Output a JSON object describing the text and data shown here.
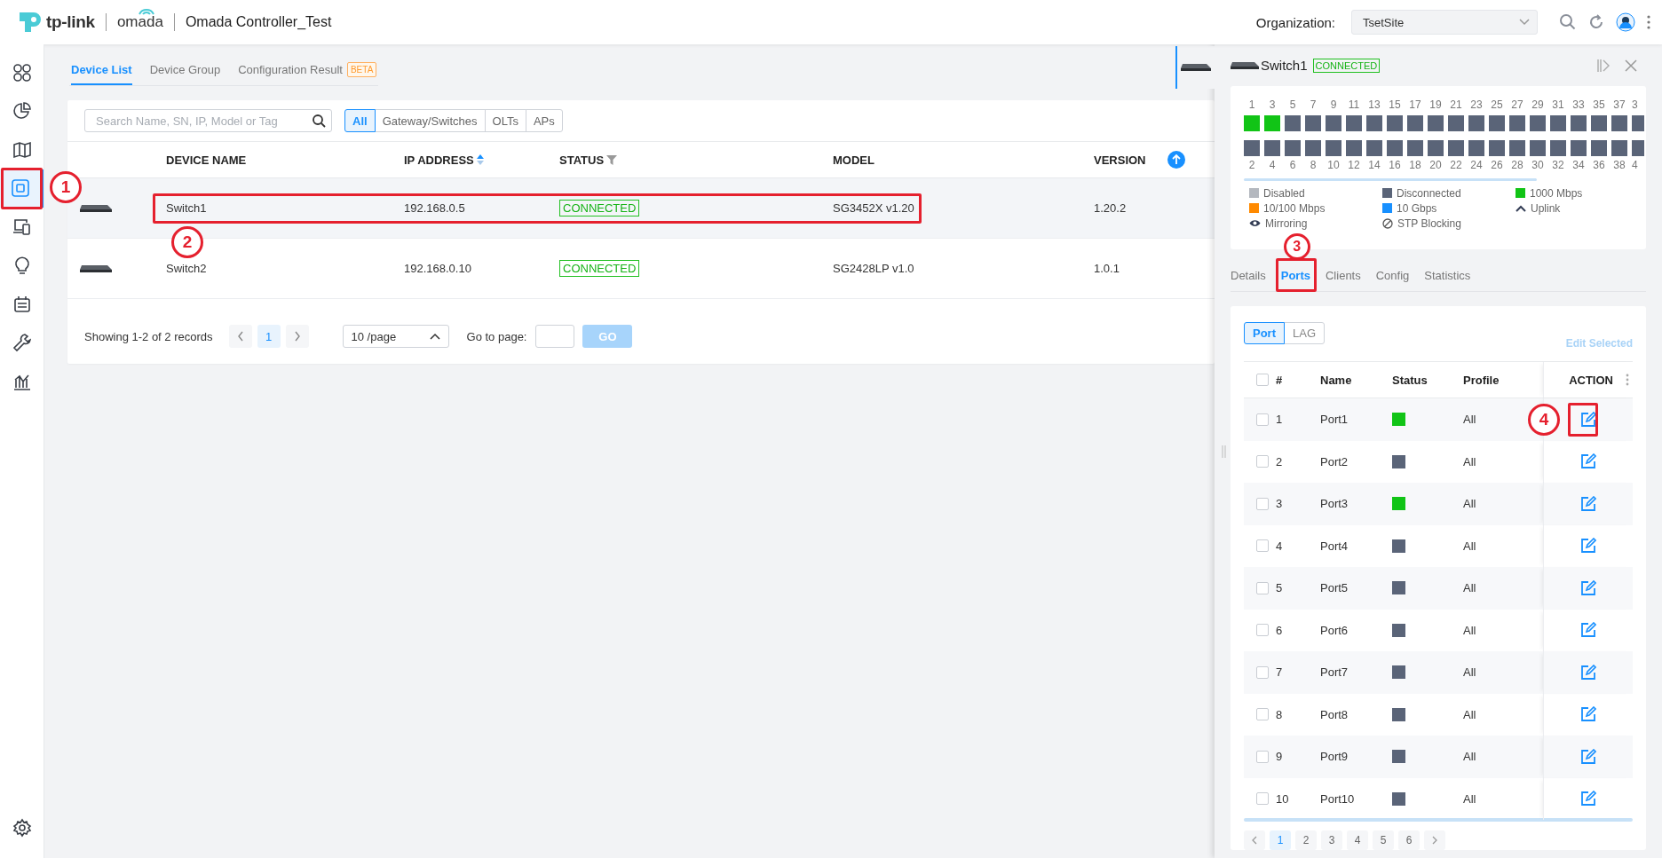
{
  "header": {
    "brand": "tp-link",
    "product": "omada",
    "title": "Omada Controller_Test",
    "organization_label": "Organization:",
    "organization": "TsetSite"
  },
  "sidebar": {
    "items": [
      {
        "kind": "dashboard",
        "selected": false
      },
      {
        "kind": "statistics",
        "selected": false
      },
      {
        "kind": "map",
        "selected": false
      },
      {
        "kind": "devices",
        "selected": true,
        "callout": "1"
      },
      {
        "kind": "clients",
        "selected": false
      },
      {
        "kind": "insight",
        "selected": false
      },
      {
        "kind": "logs",
        "selected": false
      },
      {
        "kind": "tools",
        "selected": false
      },
      {
        "kind": "reports",
        "selected": false
      }
    ],
    "bottom_items": [
      {
        "kind": "settings",
        "selected": false
      }
    ]
  },
  "tabs": [
    {
      "label": "Device List",
      "selected": true
    },
    {
      "label": "Device Group",
      "selected": false
    },
    {
      "label": "Configuration Result",
      "selected": false,
      "badge": "BETA"
    }
  ],
  "search": {
    "placeholder": "Search Name, SN, IP, Model or Tag"
  },
  "filters": [
    {
      "label": "All",
      "selected": true
    },
    {
      "label": "Gateway/Switches",
      "selected": false
    },
    {
      "label": "OLTs",
      "selected": false
    },
    {
      "label": "APs",
      "selected": false
    }
  ],
  "table": {
    "columns": [
      {
        "label": "DEVICE NAME",
        "kind": "plain"
      },
      {
        "label": "IP ADDRESS",
        "kind": "sortable"
      },
      {
        "label": "STATUS",
        "kind": "filterable"
      },
      {
        "label": "MODEL",
        "kind": "plain"
      },
      {
        "label": "VERSION",
        "kind": "upgrade"
      }
    ],
    "rows": [
      {
        "name": "Switch1",
        "ip": "192.168.0.5",
        "status": "CONNECTED",
        "model": "SG3452X v1.20",
        "version": "1.20.2",
        "hovered": true,
        "callout": "2"
      },
      {
        "name": "Switch2",
        "ip": "192.168.0.10",
        "status": "CONNECTED",
        "model": "SG2428LP v1.0",
        "version": "1.0.1",
        "hovered": false
      }
    ]
  },
  "pagination": {
    "summary": "Showing 1-2 of 2 records",
    "pages": [
      {
        "label": "1",
        "selected": true
      }
    ],
    "page_size": "10 /page",
    "goto_label": "Go to page:",
    "go": "GO"
  },
  "panel": {
    "device_name": "Switch1",
    "status": "CONNECTED",
    "ports": [
      {
        "label": "1",
        "color": "#11c416"
      },
      {
        "label": "2",
        "color": "#5a6478"
      },
      {
        "label": "3",
        "color": "#11c416"
      },
      {
        "label": "4",
        "color": "#5a6478"
      },
      {
        "label": "5",
        "color": "#5a6478"
      },
      {
        "label": "6",
        "color": "#5a6478"
      },
      {
        "label": "7",
        "color": "#5a6478"
      },
      {
        "label": "8",
        "color": "#5a6478"
      },
      {
        "label": "9",
        "color": "#5a6478"
      },
      {
        "label": "10",
        "color": "#5a6478"
      },
      {
        "label": "11",
        "color": "#5a6478"
      },
      {
        "label": "12",
        "color": "#5a6478"
      },
      {
        "label": "13",
        "color": "#5a6478"
      },
      {
        "label": "14",
        "color": "#5a6478"
      },
      {
        "label": "15",
        "color": "#5a6478"
      },
      {
        "label": "16",
        "color": "#5a6478"
      },
      {
        "label": "17",
        "color": "#5a6478"
      },
      {
        "label": "18",
        "color": "#5a6478"
      },
      {
        "label": "19",
        "color": "#5a6478"
      },
      {
        "label": "20",
        "color": "#5a6478"
      },
      {
        "label": "21",
        "color": "#5a6478"
      },
      {
        "label": "22",
        "color": "#5a6478"
      },
      {
        "label": "23",
        "color": "#5a6478"
      },
      {
        "label": "24",
        "color": "#5a6478"
      },
      {
        "label": "25",
        "color": "#5a6478"
      },
      {
        "label": "26",
        "color": "#5a6478"
      },
      {
        "label": "27",
        "color": "#5a6478"
      },
      {
        "label": "28",
        "color": "#5a6478"
      },
      {
        "label": "29",
        "color": "#5a6478"
      },
      {
        "label": "30",
        "color": "#5a6478"
      },
      {
        "label": "31",
        "color": "#5a6478"
      },
      {
        "label": "32",
        "color": "#5a6478"
      },
      {
        "label": "33",
        "color": "#5a6478"
      },
      {
        "label": "34",
        "color": "#5a6478"
      },
      {
        "label": "35",
        "color": "#5a6478"
      },
      {
        "label": "36",
        "color": "#5a6478"
      },
      {
        "label": "37",
        "color": "#5a6478"
      },
      {
        "label": "38",
        "color": "#5a6478"
      },
      {
        "label": "3",
        "color": "#5a6478"
      },
      {
        "label": "4",
        "color": "#5a6478"
      }
    ],
    "legend": [
      {
        "label": "Disabled",
        "kind": "swatch",
        "color": "#b4b8bf"
      },
      {
        "label": "Disconnected",
        "kind": "swatch",
        "color": "#5a6478"
      },
      {
        "label": "1000 Mbps",
        "kind": "swatch",
        "color": "#11c416"
      },
      {
        "label": "10/100 Mbps",
        "kind": "swatch",
        "color": "#ff8a00"
      },
      {
        "label": "10 Gbps",
        "kind": "swatch",
        "color": "#1890ff"
      },
      {
        "label": "Uplink",
        "kind": "uplink"
      },
      {
        "label": "Mirroring",
        "kind": "mirroring"
      },
      {
        "label": "STP Blocking",
        "kind": "blocking"
      }
    ],
    "tabs": [
      {
        "label": "Details",
        "selected": false
      },
      {
        "label": "Ports",
        "selected": true,
        "callout": "3"
      },
      {
        "label": "Clients",
        "selected": false
      },
      {
        "label": "Config",
        "selected": false
      },
      {
        "label": "Statistics",
        "selected": false
      }
    ],
    "segments": [
      {
        "label": "Port",
        "selected": true
      },
      {
        "label": "LAG",
        "selected": false
      }
    ],
    "edit_selected": "Edit Selected",
    "select_all_checked": false,
    "columns": [
      "#",
      "Name",
      "Status",
      "Profile",
      "ACTION"
    ],
    "rows": [
      {
        "number": "1",
        "name": "Port1",
        "color": "#11c416",
        "profile": "All",
        "checked": false,
        "callout": "4"
      },
      {
        "number": "2",
        "name": "Port2",
        "color": "#5a6478",
        "profile": "All",
        "checked": false
      },
      {
        "number": "3",
        "name": "Port3",
        "color": "#11c416",
        "profile": "All",
        "checked": false
      },
      {
        "number": "4",
        "name": "Port4",
        "color": "#5a6478",
        "profile": "All",
        "checked": false
      },
      {
        "number": "5",
        "name": "Port5",
        "color": "#5a6478",
        "profile": "All",
        "checked": false
      },
      {
        "number": "6",
        "name": "Port6",
        "color": "#5a6478",
        "profile": "All",
        "checked": false
      },
      {
        "number": "7",
        "name": "Port7",
        "color": "#5a6478",
        "profile": "All",
        "checked": false
      },
      {
        "number": "8",
        "name": "Port8",
        "color": "#5a6478",
        "profile": "All",
        "checked": false
      },
      {
        "number": "9",
        "name": "Port9",
        "color": "#5a6478",
        "profile": "All",
        "checked": false
      },
      {
        "number": "10",
        "name": "Port10",
        "color": "#5a6478",
        "profile": "All",
        "checked": false
      }
    ],
    "pages": [
      {
        "label": "1",
        "selected": true
      },
      {
        "label": "2",
        "selected": false
      },
      {
        "label": "3",
        "selected": false
      },
      {
        "label": "4",
        "selected": false
      },
      {
        "label": "5",
        "selected": false
      },
      {
        "label": "6",
        "selected": false
      }
    ]
  }
}
